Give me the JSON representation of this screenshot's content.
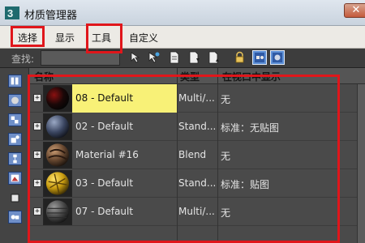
{
  "window": {
    "title": "材质管理器",
    "close_label": "✕"
  },
  "menu": {
    "items": [
      "选择",
      "显示",
      "工具",
      "自定义"
    ]
  },
  "toolbar": {
    "find_label": "查找:",
    "find_value": ""
  },
  "columns": [
    "名称",
    "类型",
    "在视口中显示"
  ],
  "rows": [
    {
      "name": "08 - Default",
      "type": "Multi/...",
      "display": "无",
      "selected": true
    },
    {
      "name": "02 - Default",
      "type": "Stand...",
      "display": "标准：无贴图",
      "selected": false
    },
    {
      "name": "Material #16",
      "type": "Blend",
      "display": "无",
      "selected": false
    },
    {
      "name": "03 - Default",
      "type": "Stand...",
      "display": "标准：贴图",
      "selected": false
    },
    {
      "name": "07 - Default",
      "type": "Multi/...",
      "display": "无",
      "selected": false
    }
  ],
  "colors": {
    "highlight": "#e0161b",
    "selected_row": "#f8f177",
    "panel_bg": "#4a4a4a"
  },
  "icons": [
    "select-objects-icon",
    "select-by-material-icon",
    "document-icon",
    "document-down-icon",
    "document-up-icon",
    "lock-icon",
    "view-scene-icon",
    "view-materials-icon"
  ]
}
